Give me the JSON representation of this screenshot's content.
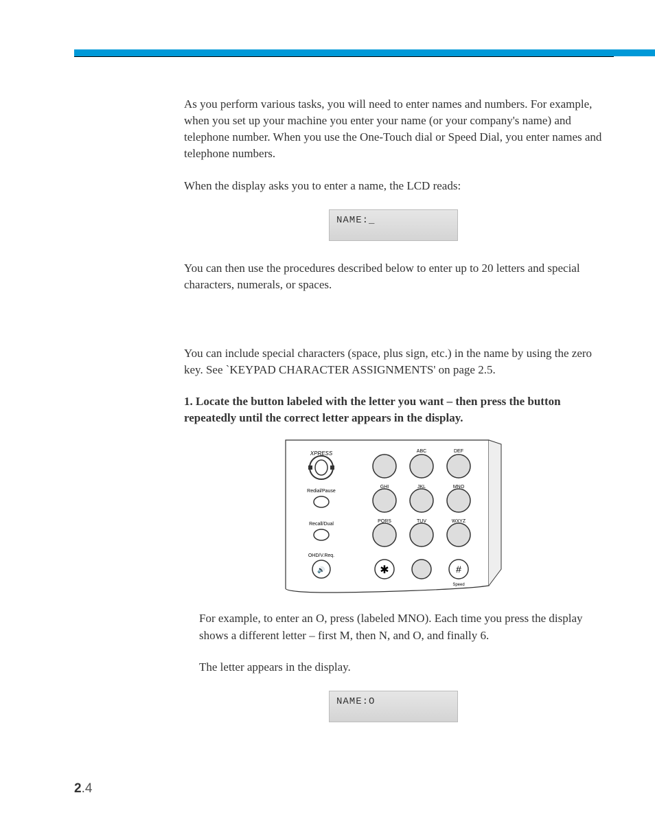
{
  "paragraphs": {
    "p1": "As you perform various tasks, you will need to enter names and numbers. For example, when you set up your machine you enter your name (or your company's name) and telephone number. When you use the One-Touch dial or Speed Dial, you enter names and telephone numbers.",
    "p2": "When the display asks you to enter a name, the LCD reads:",
    "p3": "You can then use the procedures described below to enter up to 20 letters and special characters, numerals, or spaces.",
    "p4": "You can include special characters (space, plus sign, etc.) in the name by using the zero key. See `KEYPAD CHARACTER ASSIGNMENTS' on page 2.5.",
    "step1": "1. Locate the button labeled with the letter you want – then press the button repeatedly until the correct letter appears in the display.",
    "p5a": "For example, to enter an O, press ",
    "p5b": " (labeled MNO). Each time you press ",
    "p5c": " the display shows a different letter – first M, then N, and O, and finally 6.",
    "p6": "The letter appears in the display."
  },
  "lcd": {
    "name_blank": "NAME:_",
    "name_o": "NAME:O"
  },
  "keypad": {
    "express": "XPRESS",
    "redial": "Redial/Pause",
    "recall": "Recall/Dual",
    "ohd": "OHD/V.Req.",
    "abc": "ABC",
    "def": "DEF",
    "ghi": "GHI",
    "jkl": "JKL",
    "mno": "MNO",
    "pqrs": "PQRS",
    "tuv": "TUV",
    "wxyz": "WXYZ",
    "speed": "Speed"
  },
  "page": {
    "chapter": "2",
    "num": ".4"
  }
}
